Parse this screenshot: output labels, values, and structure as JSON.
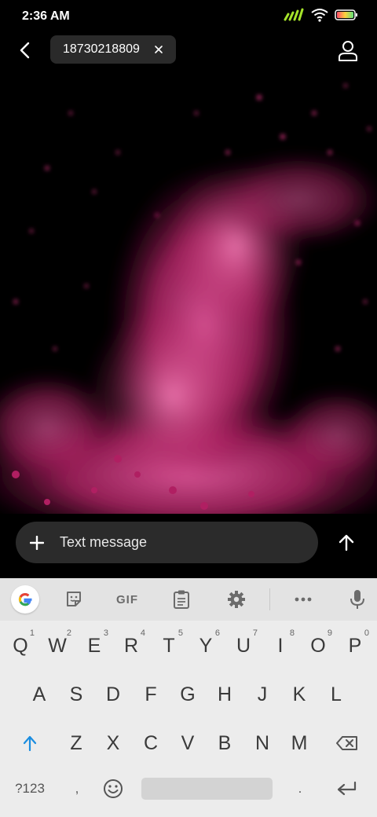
{
  "status": {
    "time": "2:36 AM"
  },
  "header": {
    "recipient": "18730218809"
  },
  "compose": {
    "placeholder": "Text message"
  },
  "keyboard": {
    "gif_label": "GIF",
    "row1": [
      {
        "k": "Q",
        "h": "1"
      },
      {
        "k": "W",
        "h": "2"
      },
      {
        "k": "E",
        "h": "3"
      },
      {
        "k": "R",
        "h": "4"
      },
      {
        "k": "T",
        "h": "5"
      },
      {
        "k": "Y",
        "h": "6"
      },
      {
        "k": "U",
        "h": "7"
      },
      {
        "k": "I",
        "h": "8"
      },
      {
        "k": "O",
        "h": "9"
      },
      {
        "k": "P",
        "h": "0"
      }
    ],
    "row2": [
      "A",
      "S",
      "D",
      "F",
      "G",
      "H",
      "J",
      "K",
      "L"
    ],
    "row3": [
      "Z",
      "X",
      "C",
      "V",
      "B",
      "N",
      "M"
    ],
    "symbols_label": "?123",
    "comma": ",",
    "period": "."
  },
  "colors": {
    "accent_magenta": "#d0307c",
    "shift_blue": "#1a8de0"
  },
  "icons": [
    "back-arrow-icon",
    "close-icon",
    "person-icon",
    "plus-icon",
    "send-arrow-icon",
    "google-icon",
    "sticker-icon",
    "clipboard-icon",
    "gear-icon",
    "more-icon",
    "mic-icon",
    "shift-icon",
    "backspace-icon",
    "emoji-icon",
    "enter-icon"
  ]
}
